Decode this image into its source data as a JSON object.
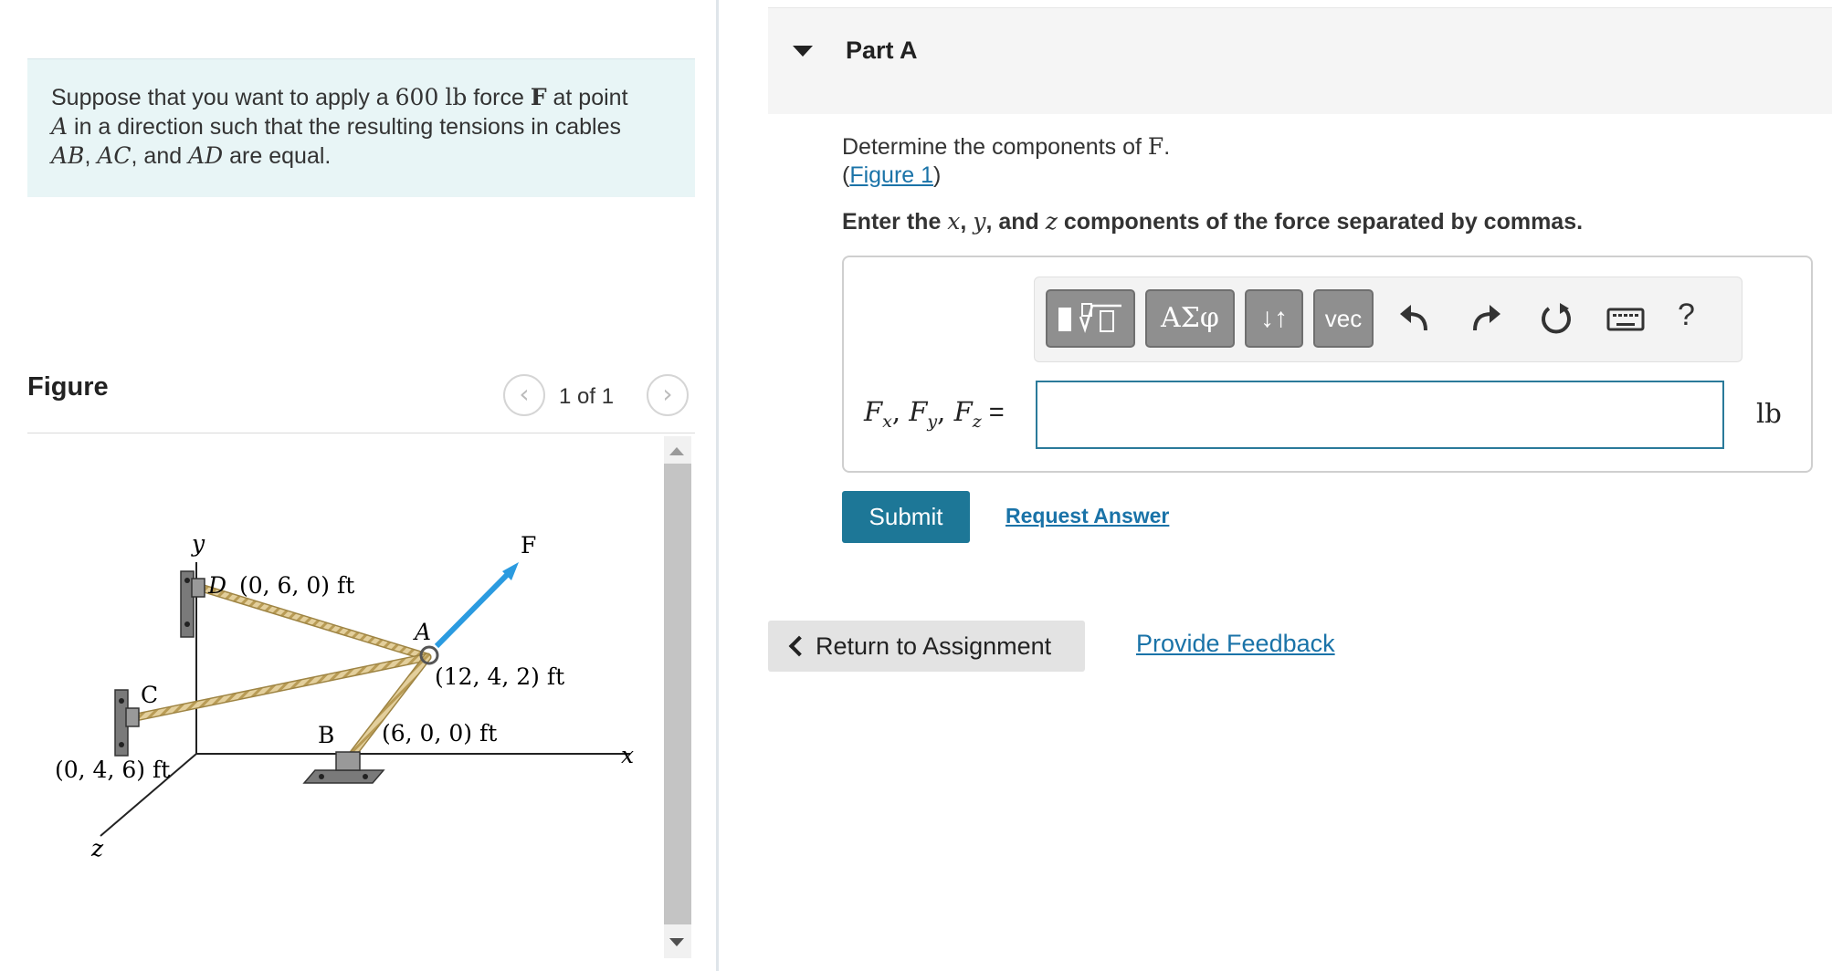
{
  "problem": {
    "line1_pre": "Suppose that you want to apply a ",
    "magnitude": "600",
    "unit": "lb",
    "line1_mid": " force ",
    "force_symbol": "F",
    "line1_post": " at point",
    "point": "A",
    "line2_post": " in a direction such that the resulting tensions in cables",
    "cable1": "AB",
    "sep1": ", ",
    "cable2": "AC",
    "sep2": ", and ",
    "cable3": "AD",
    "line3_post": " are equal."
  },
  "figure_panel": {
    "title": "Figure",
    "counter": "1 of 1",
    "prev_glyph": "‹",
    "next_glyph": "›"
  },
  "figure": {
    "axis_y": "y",
    "axis_x": "x",
    "axis_z": "z",
    "label_F": "F",
    "label_A": "A",
    "label_D": "D",
    "label_D_coord": "(0, 6, 0) ft",
    "label_C": "C",
    "label_C_coord": "(0, 4, 6) ft",
    "label_B": "B",
    "label_B_coord": "(6, 0, 0) ft",
    "label_A_coord": "(12, 4, 2) ft",
    "colors": {
      "force_arrow": "#2b9be0",
      "rope": "#dcc58e",
      "rope_edge": "#a88c48",
      "bracket": "#6f6f6f"
    }
  },
  "part": {
    "title": "Part A",
    "question_pre": "Determine the components of ",
    "question_symbol": "F",
    "question_post": ".",
    "figure_link_open": "(",
    "figure_link": "Figure 1",
    "figure_link_close": ")",
    "instruction_pre": "Enter the ",
    "var_x": "x",
    "comma1": ", ",
    "var_y": "y",
    "instruction_mid": ", and ",
    "var_z": "z",
    "instruction_post": " components of the force separated by commas."
  },
  "toolbar": {
    "symbols_label": "ΑΣφ",
    "updown_label": "↓↑",
    "vec_label": "vec",
    "help_label": "?",
    "icons": [
      "templates-icon",
      "undo-icon",
      "redo-icon",
      "reset-icon",
      "keyboard-icon"
    ]
  },
  "answer": {
    "label_F1": "F",
    "sub1": "x",
    "label_F2": "F",
    "sub2": "y",
    "label_F3": "F",
    "sub3": "z",
    "label_sep": ", ",
    "label_equals": " =",
    "value": "",
    "unit": "lb"
  },
  "actions": {
    "submit": "Submit",
    "request_answer": "Request Answer",
    "return": "Return to Assignment",
    "feedback": "Provide Feedback"
  }
}
